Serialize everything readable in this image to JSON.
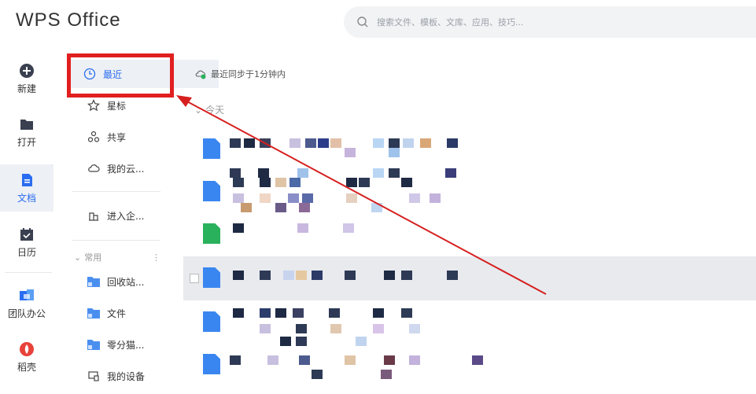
{
  "app": {
    "logo": "WPS Office"
  },
  "search": {
    "placeholder": "搜索文件、模板、文库、应用、技巧..."
  },
  "rail": [
    {
      "label": "新建",
      "icon": "plus-circle-icon"
    },
    {
      "label": "打开",
      "icon": "folder-open-icon"
    },
    {
      "label": "文档",
      "icon": "document-icon",
      "active": true
    },
    {
      "label": "日历",
      "icon": "calendar-icon"
    },
    {
      "label": "团队办公",
      "icon": "team-office-icon"
    },
    {
      "label": "稻壳",
      "icon": "docer-icon"
    }
  ],
  "nav": {
    "recent": "最近",
    "starred": "星标",
    "shared": "共享",
    "cloud": "我的云...",
    "enterprise": "进入企...",
    "section_common": "常用",
    "recycle": "回收站...",
    "files": "文件",
    "lingfen": "零分猫...",
    "devices": "我的设备"
  },
  "main": {
    "sync_status": "最近同步于1分钟内",
    "group_today": "今天"
  },
  "colors": {
    "accent": "#2b6df0",
    "highlight": "#e11f1f",
    "rail_active_bg": "#edf0f5"
  }
}
